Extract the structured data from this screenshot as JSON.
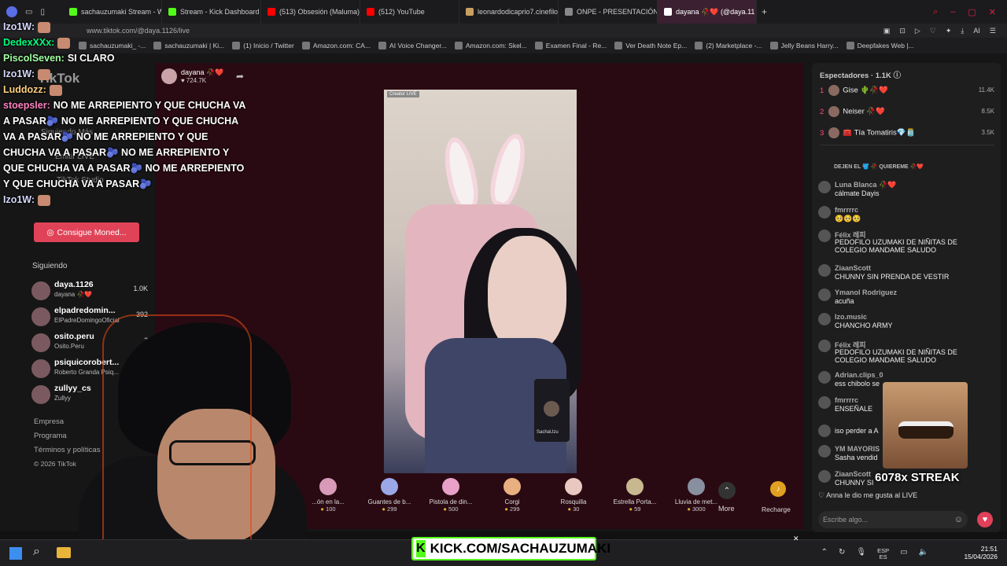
{
  "browser": {
    "tabs": [
      {
        "label": "sachauzumaki Stream - W",
        "color": "#53fc18"
      },
      {
        "label": "Stream - Kick Dashboard",
        "color": "#53fc18"
      },
      {
        "label": "(513) Obsesión (Maluma)",
        "color": "#ff0000"
      },
      {
        "label": "(512) YouTube",
        "color": "#ff0000"
      },
      {
        "label": "leonardodicaprio7.cinefilo",
        "color": "#c8a060"
      },
      {
        "label": "ONPE - PRESENTACIÓN D",
        "color": "#888888"
      },
      {
        "label": "dayana 🥀❤️ (@daya.11",
        "color": "#ffffff",
        "active": true
      }
    ],
    "url": "www.tiktok.com/@daya.1126/live",
    "bookmarks": [
      "sachauzumaki_ -...",
      "sachauzumaki | Ki...",
      "(1) Inicio / Twitter",
      "Amazon.com: CA...",
      "AI Voice Changer...",
      "Amazon.com: Skel...",
      "Examen Final - Re...",
      "Ver Death Note Ep...",
      "(2) Marketplace -...",
      "Jelly Beans Harry...",
      "Deepfakes Web |..."
    ]
  },
  "tiktok": {
    "logo": "TikTok",
    "host_name": "dayana 🥀❤️",
    "host_viewers": "724.7K",
    "coins_button": "Consigue Moned...",
    "following_label": "Siguiendo",
    "following": [
      {
        "name": "daya.1126",
        "sub": "dayana 🥀❤️",
        "count": "1.0K"
      },
      {
        "name": "elpadredomin...",
        "sub": "ElPadreDomingoOficial",
        "count": "392"
      },
      {
        "name": "osito.peru",
        "sub": "Osito.Peru",
        "count": "2"
      },
      {
        "name": "psiquicorobert...",
        "sub": "Roberto Granda Psiq...",
        "count": ""
      },
      {
        "name": "zullyy_cs",
        "sub": "Zullyy",
        "count": ""
      }
    ],
    "footer_links": [
      "Empresa",
      "Programa",
      "Términos y políticas",
      "© 2026 TikTok"
    ],
    "gifts": [
      {
        "name": "...ón en la...",
        "price": "100"
      },
      {
        "name": "Guantes de b...",
        "price": "299"
      },
      {
        "name": "Pistola de din...",
        "price": "500"
      },
      {
        "name": "Corgi",
        "price": "299"
      },
      {
        "name": "Rosquilla",
        "price": "30"
      },
      {
        "name": "Estrella Porta...",
        "price": "59"
      },
      {
        "name": "Lluvia de met...",
        "price": "3000"
      }
    ],
    "more_label": "More",
    "recharge_label": "Recharge",
    "pip_label": "SachaUzu"
  },
  "chat_overlay": [
    {
      "name": "Izo1W:",
      "color": "#d8d8ff",
      "text": ""
    },
    {
      "name": "DedexXXx:",
      "color": "#00ff7f",
      "text": ""
    },
    {
      "name": "PiscolSeven:",
      "color": "#a0ffa0",
      "text": "SI CLARO"
    },
    {
      "name": "Izo1W:",
      "color": "#d8d8ff",
      "text": ""
    },
    {
      "name": "Luddozz:",
      "color": "#ffd080",
      "text": ""
    },
    {
      "name": "stoepsler:",
      "color": "#ff80c0",
      "text": "NO ME ARREPIENTO Y QUE CHUCHA VA A PASAR🫐 NO ME ARREPIENTO Y QUE CHUCHA VA A PASAR🫐 NO ME ARREPIENTO Y QUE CHUCHA VA A PASAR🫐 NO ME ARREPIENTO Y QUE CHUCHA VA A PASAR🫐 NO ME ARREPIENTO Y QUE CHUCHA VA A PASAR🫐"
    },
    {
      "name": "Izo1W:",
      "color": "#d8d8ff",
      "text": ""
    }
  ],
  "right_panel": {
    "viewers_label": "Espectadores · 1.1K",
    "top_viewers": [
      {
        "rank": "1",
        "name": "Gise 🌵🥀❤️",
        "count": "11.4K",
        "rank_color": "#ff4d6d"
      },
      {
        "rank": "2",
        "name": "Neiser 🥀❤️",
        "count": "8.5K",
        "rank_color": "#ff4d6d"
      },
      {
        "rank": "3",
        "name": "🧰 Tía Tomatiris💎🫙",
        "count": "3.5K",
        "rank_color": "#ff4d6d"
      }
    ],
    "notice": "DEJEN EL 🪣 🥀 QUIEREME 🥀❤️",
    "comments": [
      {
        "user": "Luna Blanca 🥀❤️",
        "msg": "cálmate Dayis"
      },
      {
        "user": "fmrrrrc",
        "msg": "🥺🥺🥺"
      },
      {
        "user": "Félix 레피",
        "msg": "PEDOFILO UZUMAKI DE NIÑITAS DE COLEGIO MANDAME SALUDO"
      },
      {
        "user": "ZiaanScott",
        "msg": "CHUNNY SIN PRENDA DE VESTIR"
      },
      {
        "user": "Ymanol Rodriguez",
        "msg": "acuña"
      },
      {
        "user": "Izo.music",
        "msg": "CHANCHO ARMY"
      },
      {
        "user": "Félix 레피",
        "msg": "PEDOFILO UZUMAKI DE NIÑITAS DE COLEGIO MANDAME SALUDO"
      },
      {
        "user": "Adrian.clips_0",
        "msg": "ess chibolo se"
      },
      {
        "user": "fmrrrrc",
        "msg": "ENSEÑALE"
      },
      {
        "user": "",
        "msg": "iso perder a A"
      },
      {
        "user": "YM MAYORIS",
        "msg": "Sasha vendid"
      },
      {
        "user": "ZiaanScott",
        "msg": "CHUNNY SI"
      }
    ],
    "like_notice": "Anna le dio me gusta al LIVE",
    "composer_placeholder": "Escribe algo...",
    "streak": "6078x STREAK"
  },
  "stream_overlay": {
    "kick_url": "KICK.COM/SACHAUZUMAKI",
    "kick_logo": "K"
  },
  "taskbar": {
    "lang": "ESP",
    "lang_sub": "ES",
    "time": "21:51",
    "date": "15/04/2026"
  }
}
